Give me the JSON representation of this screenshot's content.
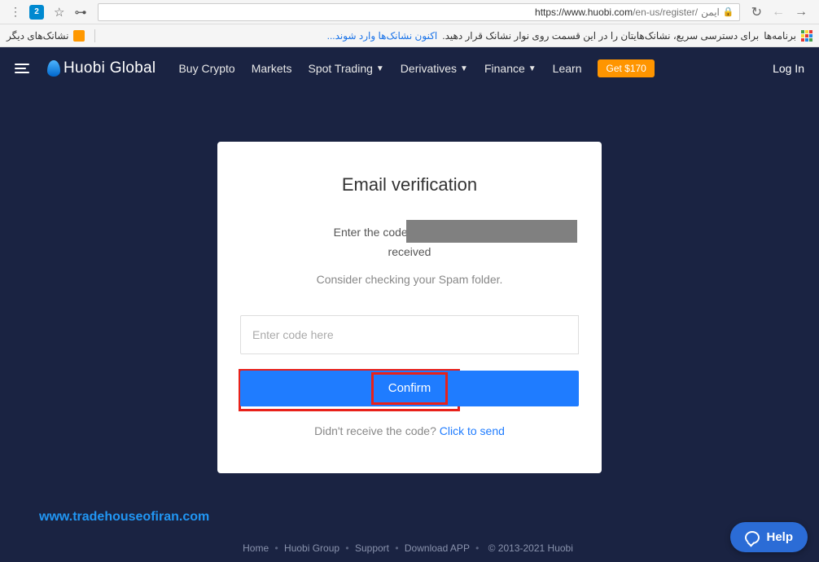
{
  "browser": {
    "url_host": "https://www.huobi.com",
    "url_path": "/en-us/register/",
    "secure_label": "ایمن"
  },
  "bookmarks": {
    "apps_label": "برنامه‌ها",
    "hint_text": "برای دسترسی سریع، نشانک‌هایتان را در این قسمت روی نوار نشانک قرار دهید.",
    "import_link": "اکنون نشانک‌ها وارد شوند...",
    "other_label": "نشانک‌های دیگر"
  },
  "header": {
    "logo_text": "Huobi Global",
    "nav": [
      "Buy Crypto",
      "Markets",
      "Spot Trading",
      "Derivatives",
      "Finance",
      "Learn"
    ],
    "nav_has_chevron": [
      false,
      false,
      true,
      true,
      true,
      false
    ],
    "badge": "Get $170",
    "login": "Log In"
  },
  "card": {
    "title": "Email verification",
    "desc_prefix": "Enter the code that your email",
    "desc_suffix": "received",
    "spam_hint": "Consider checking your Spam folder.",
    "code_placeholder": "Enter code here",
    "confirm_label": "Confirm",
    "resend_prefix": "Didn't receive the code? ",
    "resend_link": "Click to send"
  },
  "watermark": "www.tradehouseofiran.com",
  "footer": {
    "links": [
      "Home",
      "Huobi Group",
      "Support",
      "Download APP"
    ],
    "copyright": "© 2013-2021 Huobi"
  },
  "help_label": "Help"
}
